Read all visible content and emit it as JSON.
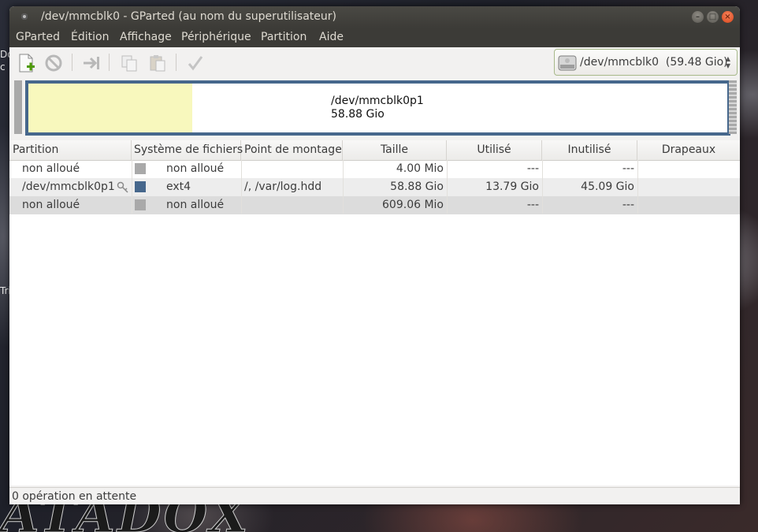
{
  "window": {
    "title": "/dev/mmcblk0 - GParted (au nom du superutilisateur)"
  },
  "menubar": {
    "items": [
      "GParted",
      "Édition",
      "Affichage",
      "Périphérique",
      "Partition",
      "Aide"
    ]
  },
  "toolbar": {
    "buttons": [
      "new-partition-icon",
      "delete-icon",
      "resize-move-icon",
      "copy-icon",
      "paste-icon",
      "apply-icon"
    ]
  },
  "device_selector": {
    "device": "/dev/mmcblk0",
    "size": "(59.48 Gio)",
    "icon": "disk-drive-icon"
  },
  "disk_map": {
    "partition_name": "/dev/mmcblk0p1",
    "partition_size": "58.88 Gio",
    "used_fraction": 0.234,
    "colors": {
      "border": "#46678c",
      "used": "#f8f8bd",
      "unallocated": "#a9a9a9"
    }
  },
  "table": {
    "columns": [
      "Partition",
      "Système de fichiers",
      "Point de montage",
      "Taille",
      "Utilisé",
      "Inutilisé",
      "Drapeaux"
    ],
    "rows": [
      {
        "partition": "non alloué",
        "fs_color": "#a9a9a9",
        "filesystem": "non alloué",
        "mount": "",
        "size": "4.00 Mio",
        "used": "---",
        "unused": "---",
        "flags": "",
        "mounted": false
      },
      {
        "partition": "/dev/mmcblk0p1",
        "fs_color": "#46678c",
        "filesystem": "ext4",
        "mount": "/, /var/log.hdd",
        "size": "58.88 Gio",
        "used": "13.79 Gio",
        "unused": "45.09 Gio",
        "flags": "",
        "mounted": true
      },
      {
        "partition": "non alloué",
        "fs_color": "#a9a9a9",
        "filesystem": "non alloué",
        "mount": "",
        "size": "609.06 Mio",
        "used": "---",
        "unused": "---",
        "flags": "",
        "mounted": false
      }
    ]
  },
  "status": {
    "text": "0 opération en attente"
  },
  "desktop": {
    "left_fragments": [
      "Do",
      "c",
      "Tri"
    ],
    "logo_text": "ATADOX"
  }
}
